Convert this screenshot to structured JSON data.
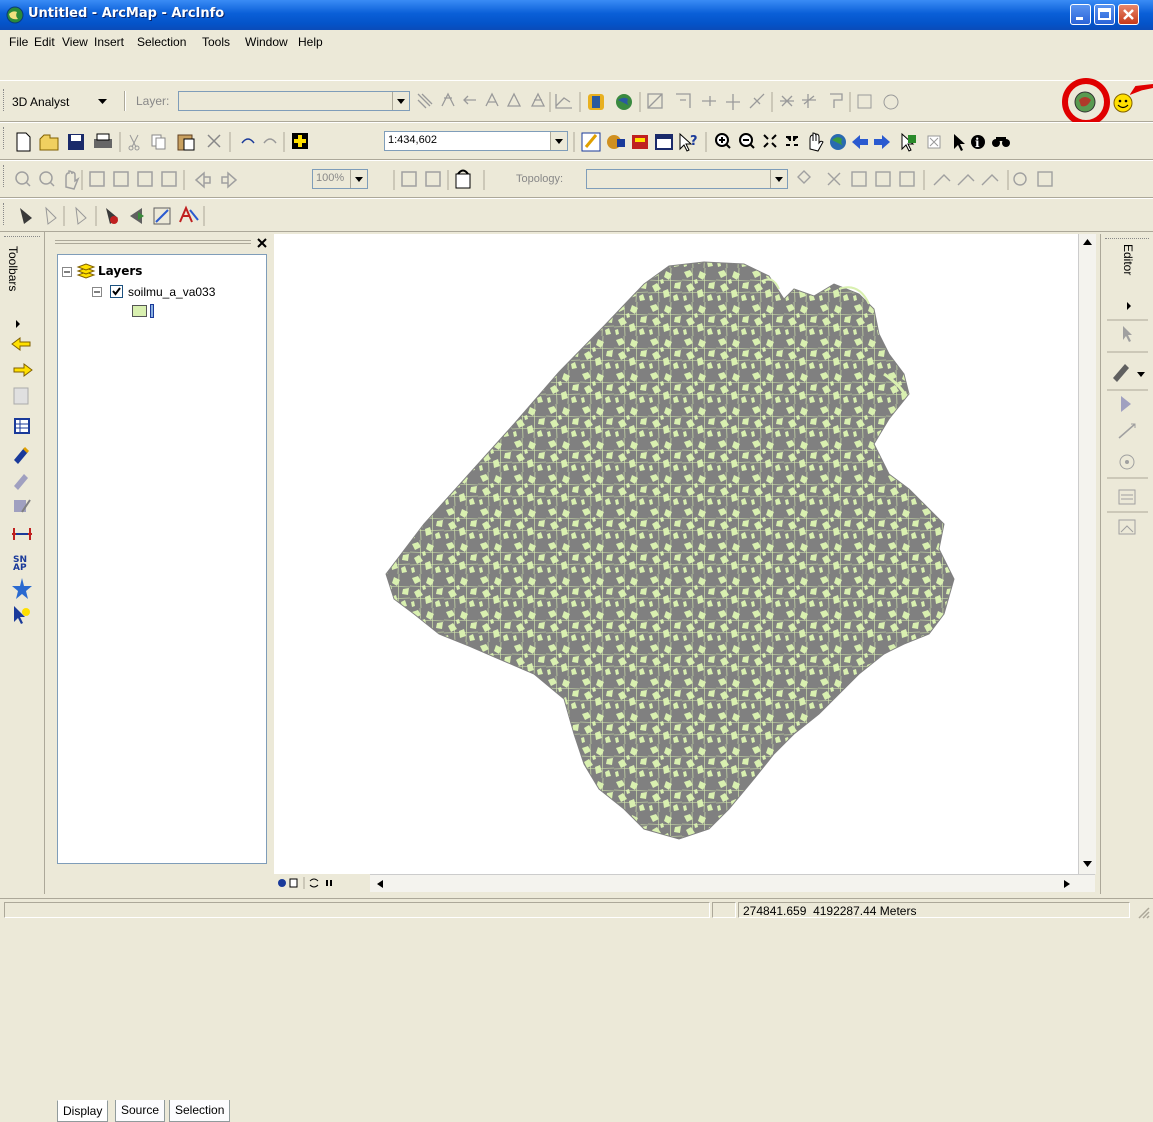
{
  "window": {
    "title": "Untitled - ArcMap - ArcInfo"
  },
  "menu": {
    "items": [
      "File",
      "Edit",
      "View",
      "Insert",
      "Selection",
      "Tools",
      "Window",
      "Help"
    ]
  },
  "toolbar_3d": {
    "dropdown_label": "3D Analyst",
    "layer_label": "Layer:",
    "layer_value": ""
  },
  "toolbar_standard": {
    "scale_value": "1:434,602"
  },
  "toolbar_layout": {
    "zoom_value": "100%",
    "topology_label": "Topology:",
    "topology_value": ""
  },
  "leftbar": {
    "label": "Toolbars"
  },
  "rightbar": {
    "label": "Editor"
  },
  "toc": {
    "root_label": "Layers",
    "layer_label": "soilmu_a_va033",
    "layer_checked": true,
    "tabs": [
      "Display",
      "Source",
      "Selection"
    ]
  },
  "status": {
    "coordinates": "274841.659  4192287.44 Meters"
  },
  "colors": {
    "polygon_fill": "#d9f0b0",
    "boundary": "#808080",
    "highlight": "#e00000"
  }
}
